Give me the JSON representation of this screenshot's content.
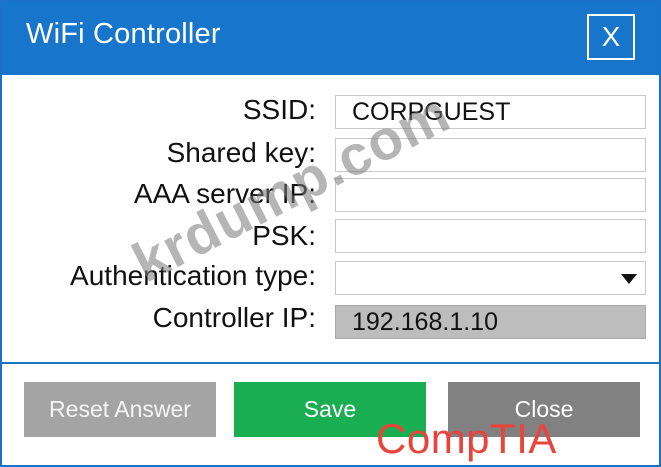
{
  "window": {
    "title": "WiFi Controller",
    "close_glyph": "X",
    "close_icon": "close-icon"
  },
  "form": {
    "ssid": {
      "label": "SSID:",
      "value": "CORPGUEST",
      "placeholder": ""
    },
    "shared_key": {
      "label": "Shared key:",
      "value": "",
      "placeholder": ""
    },
    "aaa_server": {
      "label": "AAA server IP:",
      "value": "",
      "placeholder": ""
    },
    "psk": {
      "label": "PSK:",
      "value": "",
      "placeholder": ""
    },
    "auth_type": {
      "label": "Authentication type:",
      "selected": "",
      "arrow_icon": "caret-down-icon"
    },
    "controller": {
      "label": "Controller IP:",
      "value": "192.168.1.10"
    }
  },
  "buttons": {
    "reset": "Reset Answer",
    "save": "Save",
    "close": "Close"
  },
  "overlays": {
    "watermark": "krdump.com",
    "brand": "CompTIA"
  },
  "colors": {
    "titlebar": "#1775cc",
    "save": "#1aae52",
    "reset": "#a4a4a4",
    "close": "#818181",
    "readonly_field": "#bdbdbd",
    "brand": "#e8443c"
  }
}
